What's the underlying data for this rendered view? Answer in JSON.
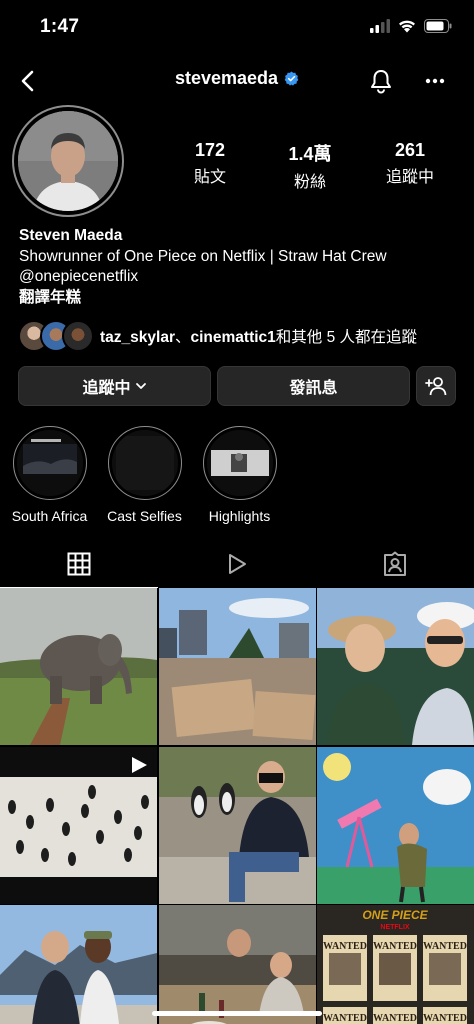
{
  "status_bar": {
    "time": "1:47"
  },
  "nav": {
    "username": "stevemaeda",
    "verified": true
  },
  "profile": {
    "stats": [
      {
        "value": "172",
        "label": "貼文"
      },
      {
        "value": "1.4萬",
        "label": "粉絲"
      },
      {
        "value": "261",
        "label": "追蹤中"
      }
    ],
    "name": "Steven Maeda",
    "bio_line": "Showrunner of One Piece on Netflix | Straw Hat Crew",
    "bio_handle": "@onepiecenetflix",
    "bio_translate": "翻譯年糕"
  },
  "followed_by": {
    "user1": "taz_skylar",
    "separator": "、",
    "user2": "cinemattic1",
    "suffix": "和其他 5 人都在追蹤"
  },
  "actions": {
    "following_label": "追蹤中",
    "message_label": "發訊息"
  },
  "highlights": [
    {
      "label": "South Africa"
    },
    {
      "label": "Cast Selfies"
    },
    {
      "label": "Highlights"
    }
  ],
  "grid_post_text": {
    "netflix": "NETFLIX",
    "wanted": "WANTED"
  },
  "colors": {
    "background": "#000000",
    "button": "#262626",
    "verified": "#3897f0"
  }
}
